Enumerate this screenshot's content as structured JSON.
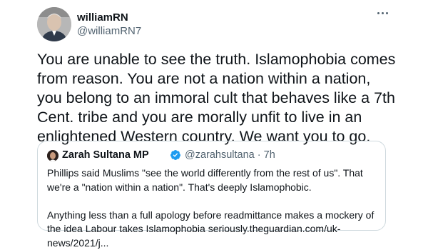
{
  "author": {
    "display_name": "williamRN",
    "handle": "@williamRN7"
  },
  "tweet": {
    "text": "You are unable to see the truth. Islamophobia comes from reason. You are not a nation within a nation, you belong to an immoral cult that behaves like a 7th Cent. tribe and you are morally unfit to live in an enlightened Western country. We want you to go."
  },
  "quoted": {
    "display_name": "Zarah Sultana MP",
    "handle_time": "@zarahsultana · 7h",
    "paragraph1": "Phillips said Muslims \"see the world differently from the rest of us\". That we're a \"nation within a nation\". That's deeply Islamophobic.",
    "paragraph2": "Anything less than a full apology before readmittance makes a mockery of the idea Labour takes Islamophobia seriously.theguardian.com/uk-news/2021/j..."
  },
  "icons": {
    "more": "more-horizontal-icon",
    "verified": "verified-badge-icon"
  },
  "colors": {
    "text": "#0f1419",
    "secondary": "#536471",
    "verified": "#1d9bf0",
    "border": "#cfd9de"
  }
}
